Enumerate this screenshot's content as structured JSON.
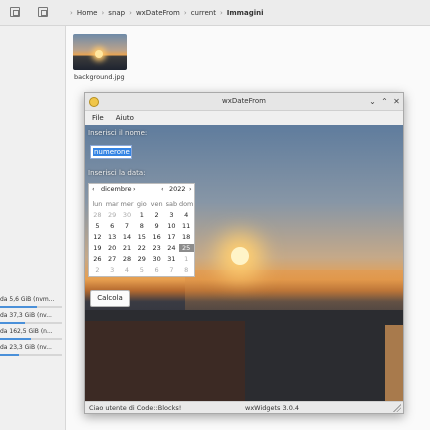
{
  "file_manager": {
    "breadcrumb": [
      "Home",
      "snap",
      "wxDateFrom",
      "current",
      "Immagini"
    ],
    "file": {
      "name": "background.jpg"
    },
    "drives": [
      {
        "label": "da 5,6 GiB (nvm...",
        "usage": 0.6
      },
      {
        "label": "da 37,3 GiB (nv...",
        "usage": 0.4
      },
      {
        "label": "da 162,5 GiB (n...",
        "usage": 0.5
      },
      {
        "label": "da 23,3 GiB (nv...",
        "usage": 0.3
      }
    ]
  },
  "window": {
    "title": "wxDateFrom",
    "controls": {
      "minimize": "⌄",
      "maximize": "⌃",
      "close": "✕"
    },
    "menu": [
      "File",
      "Aiuto"
    ],
    "name_label": "Inserisci il nome:",
    "name_value": "numerone",
    "date_label": "Inserisci la data:",
    "calendar": {
      "month": "dicembre",
      "year": "2022",
      "weekdays": [
        "lun",
        "mar",
        "mer",
        "gio",
        "ven",
        "sab",
        "dom"
      ],
      "weeks": [
        [
          "28",
          "29",
          "30",
          "1",
          "2",
          "3",
          "4"
        ],
        [
          "5",
          "6",
          "7",
          "8",
          "9",
          "10",
          "11"
        ],
        [
          "12",
          "13",
          "14",
          "15",
          "16",
          "17",
          "18"
        ],
        [
          "19",
          "20",
          "21",
          "22",
          "23",
          "24",
          "25"
        ],
        [
          "26",
          "27",
          "28",
          "29",
          "30",
          "31",
          "1"
        ],
        [
          "2",
          "3",
          "4",
          "5",
          "6",
          "7",
          "8"
        ]
      ],
      "selected": "25"
    },
    "button_label": "Calcola",
    "status_left": "Ciao utente di Code::Blocks!",
    "status_right": "wxWidgets 3.0.4"
  }
}
